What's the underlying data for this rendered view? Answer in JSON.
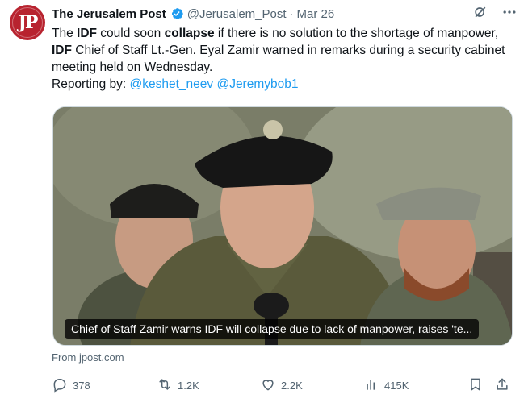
{
  "tweet": {
    "author_name": "The Jerusalem Post",
    "author_handle": "@Jerusalem_Post",
    "separator": "·",
    "timestamp": "Mar 26",
    "avatar_text": "JP",
    "text_parts": {
      "p1": "The ",
      "b1": "IDF",
      "p2": " could soon ",
      "b2": "collapse",
      "p3": " if there is no solution to the shortage of manpower, ",
      "b3": "IDF",
      "p4": " Chief of Staff Lt.-Gen. Eyal Zamir warned in remarks during a security cabinet meeting held on Wednesday.",
      "reporting_label": "Reporting by: ",
      "mention1": "@keshet_neev",
      "mention2": "@Jeremybob1"
    },
    "media": {
      "caption": "Chief of Staff Zamir warns IDF will collapse due to lack of manpower, raises 'te..."
    },
    "source": "From jpost.com"
  },
  "actions": {
    "replies": "378",
    "reposts": "1.2K",
    "likes": "2.2K",
    "views": "415K"
  },
  "colors": {
    "accent": "#1d9bf0",
    "muted": "#536471",
    "brand": "#b8232f"
  },
  "icons": [
    "verified-icon",
    "grok-icon",
    "more-icon",
    "reply-icon",
    "repost-icon",
    "like-icon",
    "views-icon",
    "bookmark-icon",
    "share-icon"
  ]
}
